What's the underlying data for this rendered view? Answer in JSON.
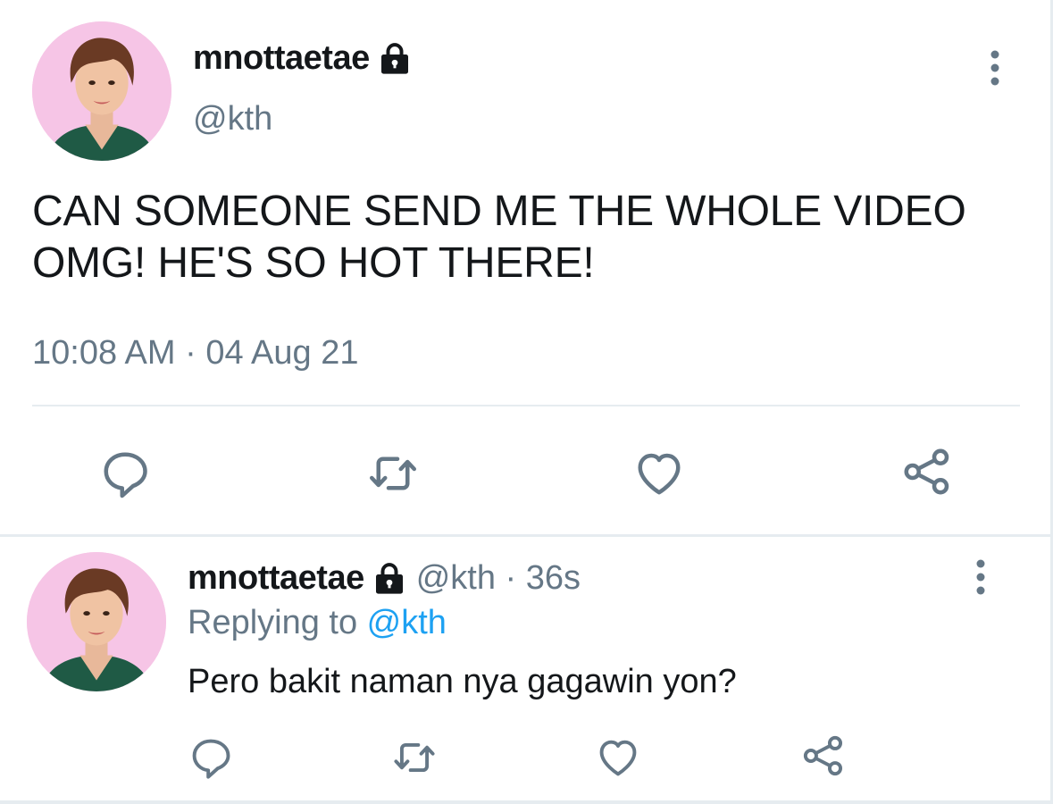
{
  "main_tweet": {
    "display_name": "mnottaetae",
    "handle": "@kth",
    "text_line1": "CAN SOMEONE SEND ME THE WHOLE VIDEO",
    "text_line2": "OMG! HE'S SO HOT THERE!",
    "timestamp": "10:08 AM · 04 Aug 21",
    "avatar_icon": "profile-photo",
    "lock_icon": "lock-icon",
    "actions": [
      "reply-icon",
      "retweet-icon",
      "like-icon",
      "share-icon"
    ]
  },
  "reply": {
    "display_name": "mnottaetae",
    "meta": "@kth · 36s",
    "replying_prefix": "Replying to ",
    "replying_mention": "@kth",
    "text": "Pero bakit naman nya gagawin yon?",
    "actions": [
      "reply-icon",
      "retweet-icon",
      "like-icon",
      "share-icon"
    ]
  },
  "colors": {
    "text": "#14171a",
    "secondary": "#657786",
    "mention": "#1da1f2",
    "divider": "#e6ecf0",
    "icon": "#657786"
  }
}
